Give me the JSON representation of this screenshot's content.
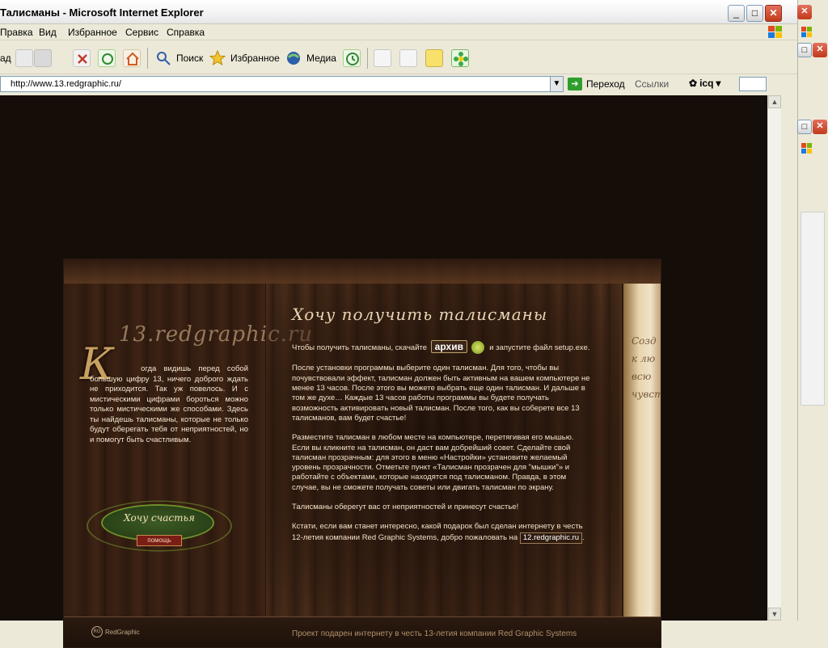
{
  "window": {
    "title": "Талисманы - Microsoft Internet Explorer",
    "buttons": {
      "minimize": "_",
      "maximize": "□",
      "close": "✕"
    }
  },
  "menu": [
    "Правка",
    "Вид",
    "Избранное",
    "Сервис",
    "Справка"
  ],
  "toolbar": {
    "back": "ад",
    "search": "Поиск",
    "favorites": "Избранное",
    "media": "Медиа"
  },
  "address": {
    "url": "http://www.13.redgraphic.ru/",
    "go": "Переход",
    "links": "Ссылки",
    "icq": "icq"
  },
  "site": {
    "brand": "13.redgraphic.ru",
    "bigLetter": "К",
    "intro": "огда видишь перед собой большую цифру 13, ничего доброго ждать не приходится. Так уж повелось. И с мистическими цифрами бороться можно только мистическими же способами. Здесь ты найдешь талисманы, которые не только будут оберегать тебя от неприятностей, но и помогут быть счастливым.",
    "badge": {
      "label": "Хочу счастья",
      "ribbon": "помощь"
    },
    "heading": "Хочу получить талисманы",
    "p1_before": "Чтобы получить талисманы, скачайте",
    "archive": "архив",
    "p1_after": "и запустите файл setup.exe.",
    "p2": "После установки программы выберите один талисман. Для того, чтобы вы почувствовали эффект, талисман должен быть активным на вашем компьютере не менее 13 часов. После этого вы можете выбрать еще один талисман. И дальше в том же духе… Каждые 13 часов работы программы вы будете получать возможность активировать новый талисман. После того, как вы соберете все 13 талисманов, вам будет счастье!",
    "p3": "Разместите талисман в любом месте на компьютере, перетягивая его мышью. Если вы кликните на талисман, он даст вам добрейший совет. Сделайте свой талисман прозрачным: для этого в меню «Настройки» установите желаемый уровень прозрачности. Отметьте пункт «Талисман прозрачен для \"мышки\"» и работайте с объектами, которые находятся под талисманом. Правда, в этом случае, вы не сможете получать советы или двигать талисман по экрану.",
    "p4": "Талисманы оберегут вас от неприятностей и принесут счастье!",
    "p5_before": "Кстати, если вам станет интересно, какой подарок был сделан интернету в честь 12-летия компании Red Graphic Systems, добро пожаловать на",
    "p5_link": "12.redgraphic.ru",
    "p5_after": ".",
    "footer_logo": "RedGraphic",
    "footer_tag": "Проект подарен интернету в честь 13-летия компании Red Graphic Systems",
    "parchment_text": [
      "Созд",
      "к лю",
      "всю",
      "чувст"
    ]
  },
  "colors": {
    "pageBg": "#140d08",
    "woodA": "#3b2416",
    "woodB": "#53331e",
    "text": "#f1e2c9",
    "accentGold": "#bfa07c",
    "badgeGreen": "#3c5b23",
    "ribbonRed": "#7a1d14"
  },
  "icons": {
    "back": "back-arrow-icon",
    "forward": "forward-arrow-icon",
    "stop": "stop-icon",
    "refresh": "refresh-icon",
    "home": "home-icon",
    "search": "search-icon",
    "favorites": "star-icon",
    "media": "media-globe-icon",
    "history": "history-icon",
    "print": "print-icon",
    "edit": "edit-icon",
    "notes": "note-icon",
    "icq": "icq-flower-icon"
  }
}
